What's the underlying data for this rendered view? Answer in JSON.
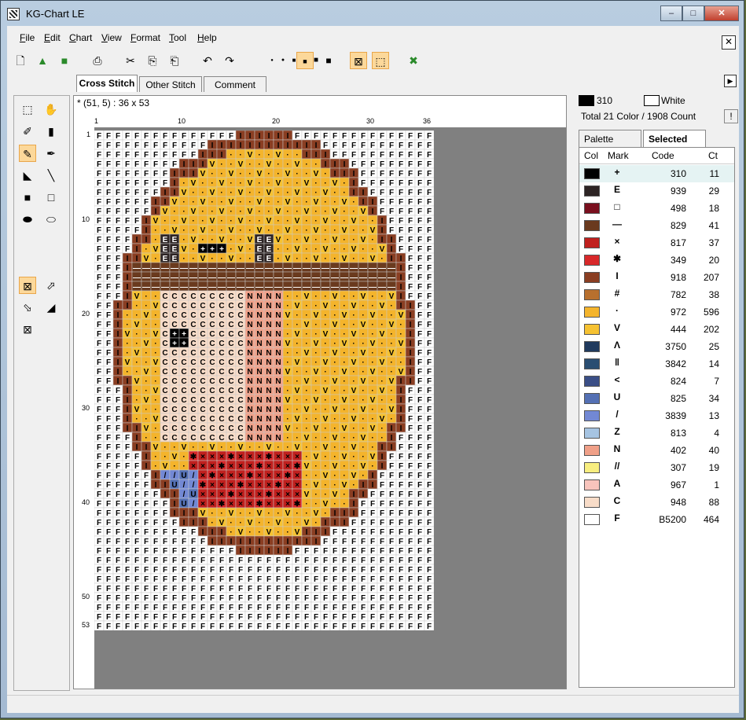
{
  "window": {
    "title": "KG-Chart LE",
    "min_label": "0",
    "max_label": "1",
    "close_label": "r"
  },
  "menu": [
    {
      "key": "F",
      "rest": "ile"
    },
    {
      "key": "E",
      "rest": "dit"
    },
    {
      "key": "C",
      "rest": "hart"
    },
    {
      "key": "V",
      "rest": "iew"
    },
    {
      "key": "F",
      "rest": "ormat"
    },
    {
      "key": "T",
      "rest": "ool"
    },
    {
      "key": "H",
      "rest": "elp"
    }
  ],
  "mdi_close": "✕",
  "toolbar_icons": [
    "new-icon",
    "open-icon",
    "save-icon",
    "print-icon",
    "cut-icon",
    "copy-icon",
    "paste-icon",
    "undo-icon",
    "redo-icon",
    "dot-tiny-icon",
    "dot-small-icon",
    "dot-medium-icon",
    "dot-large-icon",
    "dot-xlarge-icon",
    "dot-xxlarge-icon",
    "cross-mode-icon",
    "half-mode-icon",
    "select-color-icon"
  ],
  "tabs": {
    "cross": "Cross Stitch",
    "other": "Other Stitch",
    "comment": "Comment"
  },
  "coord": "* (51,  5)   : 36 x 53",
  "ruler_top": [
    "1",
    "10",
    "20",
    "30",
    "36"
  ],
  "ruler_left": [
    "1",
    "10",
    "20",
    "30",
    "40",
    "50",
    "53"
  ],
  "current": {
    "color1_code": "310",
    "color1_hex": "#000000",
    "color2_name": "White",
    "color2_hex": "#ffffff"
  },
  "total": "Total 21 Color / 1908 Count",
  "total_btn": "!",
  "ptabs": {
    "palette": "Palette",
    "selected": "Selected"
  },
  "colors_header": {
    "col": "Col",
    "mark": "Mark",
    "code": "Code",
    "ct": "Ct"
  },
  "colors": [
    {
      "hex": "#000000",
      "mark": "+",
      "code": "310",
      "ct": "11"
    },
    {
      "hex": "#2d2424",
      "mark": "E",
      "code": "939",
      "ct": "29"
    },
    {
      "hex": "#7a0f1e",
      "mark": "□",
      "code": "498",
      "ct": "18"
    },
    {
      "hex": "#6a3a1e",
      "mark": "—",
      "code": "829",
      "ct": "41"
    },
    {
      "hex": "#c0201e",
      "mark": "×",
      "code": "817",
      "ct": "37"
    },
    {
      "hex": "#d8282a",
      "mark": "✱",
      "code": "349",
      "ct": "20"
    },
    {
      "hex": "#8a3e22",
      "mark": "I",
      "code": "918",
      "ct": "207"
    },
    {
      "hex": "#b8702e",
      "mark": "#",
      "code": "782",
      "ct": "38"
    },
    {
      "hex": "#f4b42c",
      "mark": "·",
      "code": "972",
      "ct": "596"
    },
    {
      "hex": "#f6c232",
      "mark": "V",
      "code": "444",
      "ct": "202"
    },
    {
      "hex": "#203a5e",
      "mark": "Λ",
      "code": "3750",
      "ct": "25"
    },
    {
      "hex": "#2a4e72",
      "mark": "‖",
      "code": "3842",
      "ct": "14"
    },
    {
      "hex": "#3a4e86",
      "mark": "<",
      "code": "824",
      "ct": "7"
    },
    {
      "hex": "#5470b4",
      "mark": "U",
      "code": "825",
      "ct": "34"
    },
    {
      "hex": "#7288d4",
      "mark": "/",
      "code": "3839",
      "ct": "13"
    },
    {
      "hex": "#a6c4e2",
      "mark": "Z",
      "code": "813",
      "ct": "4"
    },
    {
      "hex": "#f0a088",
      "mark": "N",
      "code": "402",
      "ct": "40"
    },
    {
      "hex": "#f8ee80",
      "mark": "//",
      "code": "307",
      "ct": "19"
    },
    {
      "hex": "#f8c4bc",
      "mark": "A",
      "code": "967",
      "ct": "1"
    },
    {
      "hex": "#f8dcc8",
      "mark": "C",
      "code": "948",
      "ct": "88"
    },
    {
      "hex": "#ffffff",
      "mark": "F",
      "code": "B5200",
      "ct": "464"
    }
  ]
}
